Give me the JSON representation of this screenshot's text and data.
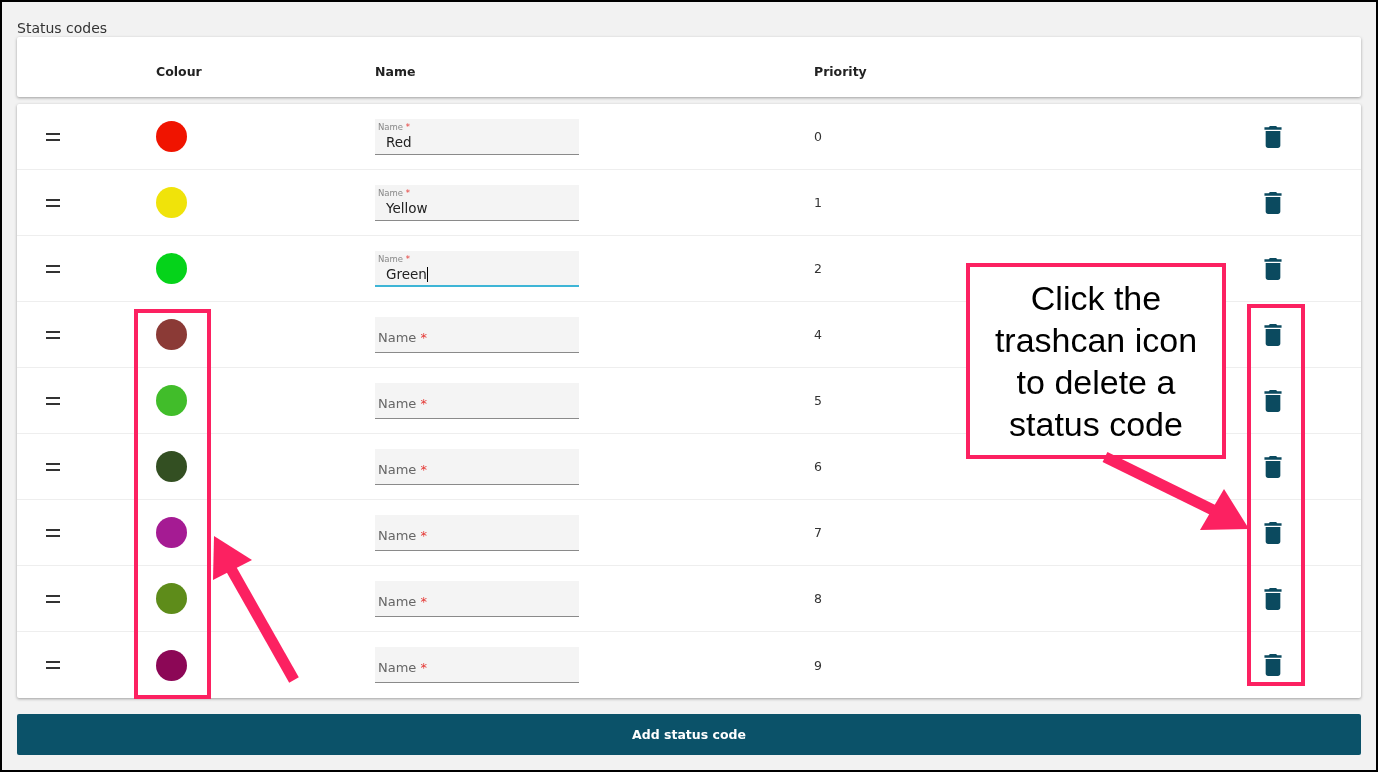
{
  "title": "Status codes",
  "columns": [
    "Colour",
    "Name",
    "Priority"
  ],
  "rows": [
    {
      "color": "#f01400",
      "name_field": {
        "label": "Name",
        "required_mark": "*",
        "value": "Red",
        "focused": false
      },
      "priority": "0"
    },
    {
      "color": "#f0e30a",
      "name_field": {
        "label": "Name",
        "required_mark": "*",
        "value": "Yellow",
        "focused": false
      },
      "priority": "1"
    },
    {
      "color": "#05d31a",
      "name_field": {
        "label": "Name",
        "required_mark": "*",
        "value": "Green",
        "focused": true
      },
      "priority": "2"
    },
    {
      "color": "#8b3a36",
      "name_field": {
        "label": "Name",
        "required_mark": "*",
        "focused": false
      },
      "priority": "4"
    },
    {
      "color": "#41bd2a",
      "name_field": {
        "label": "Name",
        "required_mark": "*",
        "focused": false
      },
      "priority": "5"
    },
    {
      "color": "#334f22",
      "name_field": {
        "label": "Name",
        "required_mark": "*",
        "focused": false
      },
      "priority": "6"
    },
    {
      "color": "#a51b93",
      "name_field": {
        "label": "Name",
        "required_mark": "*",
        "focused": false
      },
      "priority": "7"
    },
    {
      "color": "#5e8c1a",
      "name_field": {
        "label": "Name",
        "required_mark": "*",
        "focused": false
      },
      "priority": "8"
    },
    {
      "color": "#8c0756",
      "name_field": {
        "label": "Name",
        "required_mark": "*",
        "focused": false
      },
      "priority": "9"
    }
  ],
  "add_button": "Add status code",
  "annotation": {
    "callout": "Click the trashcan icon to delete a status code"
  }
}
